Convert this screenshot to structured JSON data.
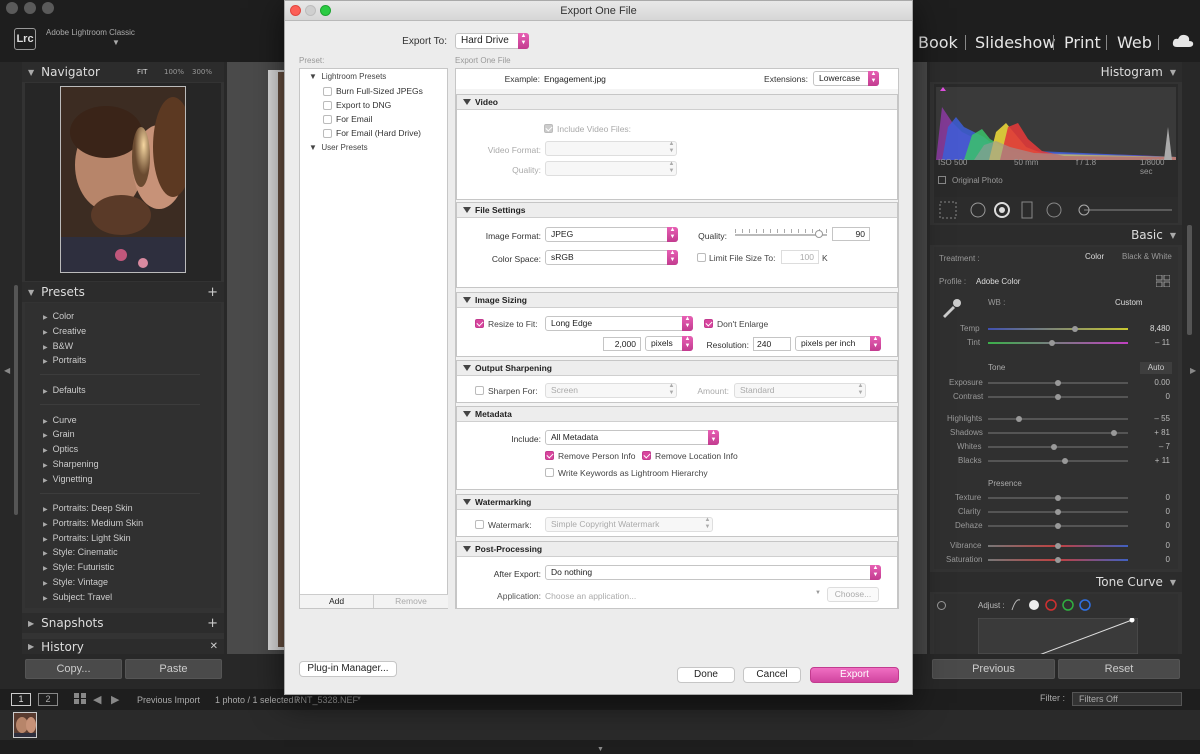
{
  "app": {
    "name": "Adobe Lightroom Classic",
    "logo": "Lrc"
  },
  "modules": [
    "Book",
    "Slideshow",
    "Print",
    "Web"
  ],
  "navigator": {
    "title": "Navigator",
    "zoom_options": [
      "FIT",
      "100%",
      "300%"
    ]
  },
  "presets_panel": {
    "title": "Presets",
    "groups": [
      [
        "Color",
        "Creative",
        "B&W",
        "Portraits"
      ],
      [
        "Defaults"
      ],
      [
        "Curve",
        "Grain",
        "Optics",
        "Sharpening",
        "Vignetting"
      ],
      [
        "Portraits: Deep Skin",
        "Portraits: Medium Skin",
        "Portraits: Light Skin",
        "Style: Cinematic",
        "Style: Futuristic",
        "Style: Vintage",
        "Subject: Travel"
      ]
    ]
  },
  "snapshots": {
    "title": "Snapshots"
  },
  "history": {
    "title": "History"
  },
  "left_buttons": {
    "copy": "Copy...",
    "paste": "Paste"
  },
  "histogram": {
    "title": "Histogram",
    "iso": "ISO 500",
    "focal": "50 mm",
    "aperture": "f / 1.8",
    "shutter": "1/8000 sec",
    "original": "Original Photo"
  },
  "basic": {
    "title": "Basic",
    "treatment_label": "Treatment :",
    "color": "Color",
    "bw": "Black & White",
    "profile_label": "Profile :",
    "profile_value": "Adobe Color",
    "wb_label": "WB :",
    "wb_value": "Custom",
    "temp": {
      "label": "Temp",
      "value": "8,480",
      "pos": 0.62
    },
    "tint": {
      "label": "Tint",
      "value": "– 11",
      "pos": 0.46
    },
    "tone_label": "Tone",
    "auto": "Auto",
    "tone": [
      {
        "label": "Exposure",
        "value": "0.00",
        "pos": 0.5
      },
      {
        "label": "Contrast",
        "value": "0",
        "pos": 0.5
      },
      {
        "label": "Highlights",
        "value": "– 55",
        "pos": 0.22
      },
      {
        "label": "Shadows",
        "value": "+ 81",
        "pos": 0.9
      },
      {
        "label": "Whites",
        "value": "– 7",
        "pos": 0.47
      },
      {
        "label": "Blacks",
        "value": "+ 11",
        "pos": 0.55
      }
    ],
    "presence_label": "Presence",
    "presence": [
      {
        "label": "Texture",
        "value": "0",
        "pos": 0.5
      },
      {
        "label": "Clarity",
        "value": "0",
        "pos": 0.5
      },
      {
        "label": "Dehaze",
        "value": "0",
        "pos": 0.5
      },
      {
        "label": "Vibrance",
        "value": "0",
        "pos": 0.5
      },
      {
        "label": "Saturation",
        "value": "0",
        "pos": 0.5
      }
    ]
  },
  "tone_curve": {
    "title": "Tone Curve",
    "adjust": "Adjust :"
  },
  "right_buttons": {
    "previous": "Previous",
    "reset": "Reset"
  },
  "filmstrip": {
    "pages": [
      "1",
      "2"
    ],
    "source": "Previous Import",
    "info": "1 photo / 1 selected /",
    "file": "RNT_5328.NEF",
    "filter_label": "Filter :",
    "filter_value": "Filters Off"
  },
  "dialog": {
    "title": "Export One File",
    "export_to_label": "Export To:",
    "export_to_value": "Hard Drive",
    "preset_label": "Preset:",
    "right_header": "Export One File",
    "presets": {
      "lightroom": "Lightroom Presets",
      "items": [
        "Burn Full-Sized JPEGs",
        "Export to DNG",
        "For Email",
        "For Email (Hard Drive)"
      ],
      "user": "User Presets"
    },
    "add": "Add",
    "remove": "Remove",
    "example_label": "Example:",
    "example_value": "Engagement.jpg",
    "extensions_label": "Extensions:",
    "extensions_value": "Lowercase",
    "video": {
      "title": "Video",
      "include": "Include Video Files:",
      "format_label": "Video Format:",
      "quality_label": "Quality:"
    },
    "file_settings": {
      "title": "File Settings",
      "format_label": "Image Format:",
      "format_value": "JPEG",
      "quality_label": "Quality:",
      "quality_value": "90",
      "quality_pos": 0.9,
      "color_label": "Color Space:",
      "color_value": "sRGB",
      "limit_label": "Limit File Size To:",
      "limit_value": "100",
      "limit_unit": "K"
    },
    "image_sizing": {
      "title": "Image Sizing",
      "resize_label": "Resize to Fit:",
      "resize_value": "Long Edge",
      "dont_enlarge": "Don't Enlarge",
      "size_value": "2,000",
      "size_unit": "pixels",
      "res_label": "Resolution:",
      "res_value": "240",
      "res_unit": "pixels per inch"
    },
    "sharpening": {
      "title": "Output Sharpening",
      "label": "Sharpen For:",
      "value": "Screen",
      "amount_label": "Amount:",
      "amount_value": "Standard"
    },
    "metadata": {
      "title": "Metadata",
      "include_label": "Include:",
      "include_value": "All Metadata",
      "remove_person": "Remove Person Info",
      "remove_location": "Remove Location Info",
      "keywords": "Write Keywords as Lightroom Hierarchy"
    },
    "watermarking": {
      "title": "Watermarking",
      "label": "Watermark:",
      "value": "Simple Copyright Watermark"
    },
    "post": {
      "title": "Post-Processing",
      "after_label": "After Export:",
      "after_value": "Do nothing",
      "app_label": "Application:",
      "app_placeholder": "Choose an application...",
      "choose": "Choose..."
    },
    "plugin": "Plug-in Manager...",
    "done": "Done",
    "cancel": "Cancel",
    "export": "Export"
  }
}
